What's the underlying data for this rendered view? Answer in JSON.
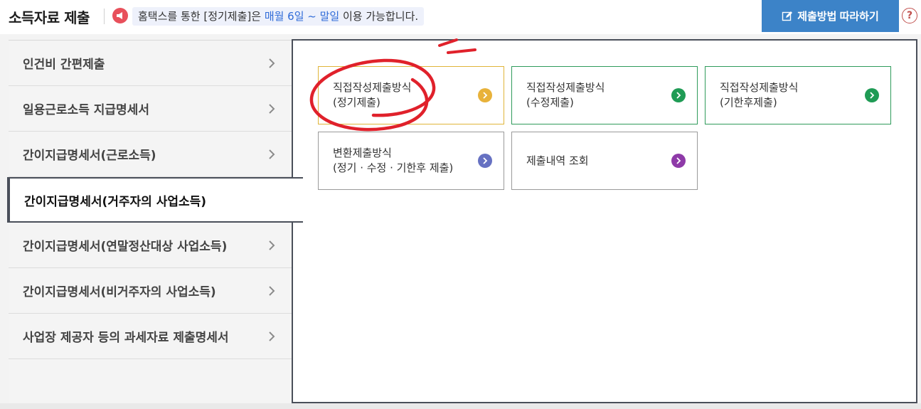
{
  "header": {
    "title": "소득자료 제출",
    "notice": {
      "prefix": "홈택스를 통한 [정기제출]은 ",
      "highlight": "매월 6일 ~ 말일",
      "suffix": " 이용 가능합니다."
    },
    "guide_button": "제출방법 따라하기",
    "help_symbol": "?"
  },
  "sidebar": {
    "items": [
      {
        "label": "인건비 간편제출"
      },
      {
        "label": "일용근로소득 지급명세서"
      },
      {
        "label": "간이지급명세서(근로소득)"
      },
      {
        "label": "간이지급명세서(거주자의 사업소득)",
        "active": true
      },
      {
        "label": "간이지급명세서(연말정산대상 사업소득)"
      },
      {
        "label": "간이지급명세서(비거주자의 사업소득)"
      },
      {
        "label": "사업장 제공자 등의 과세자료 제출명세서"
      }
    ]
  },
  "cards": [
    {
      "line1": "직접작성제출방식",
      "line2": "(정기제출)",
      "icon_color": "#e8b23a"
    },
    {
      "line1": "직접작성제출방식",
      "line2": "(수정제출)",
      "icon_color": "#1f9b55"
    },
    {
      "line1": "직접작성제출방식",
      "line2": "(기한후제출)",
      "icon_color": "#1f9b55"
    },
    {
      "line1": "변환제출방식",
      "line2": "(정기 · 수정 · 기한후 제출)",
      "icon_color": "#6671c2"
    },
    {
      "line1": "제출내역 조회",
      "line2": "",
      "icon_color": "#8e3aa8"
    }
  ],
  "colors": {
    "accent_blue": "#3c83c8",
    "green": "#1f9b55",
    "annotation_red": "#e0212b"
  }
}
